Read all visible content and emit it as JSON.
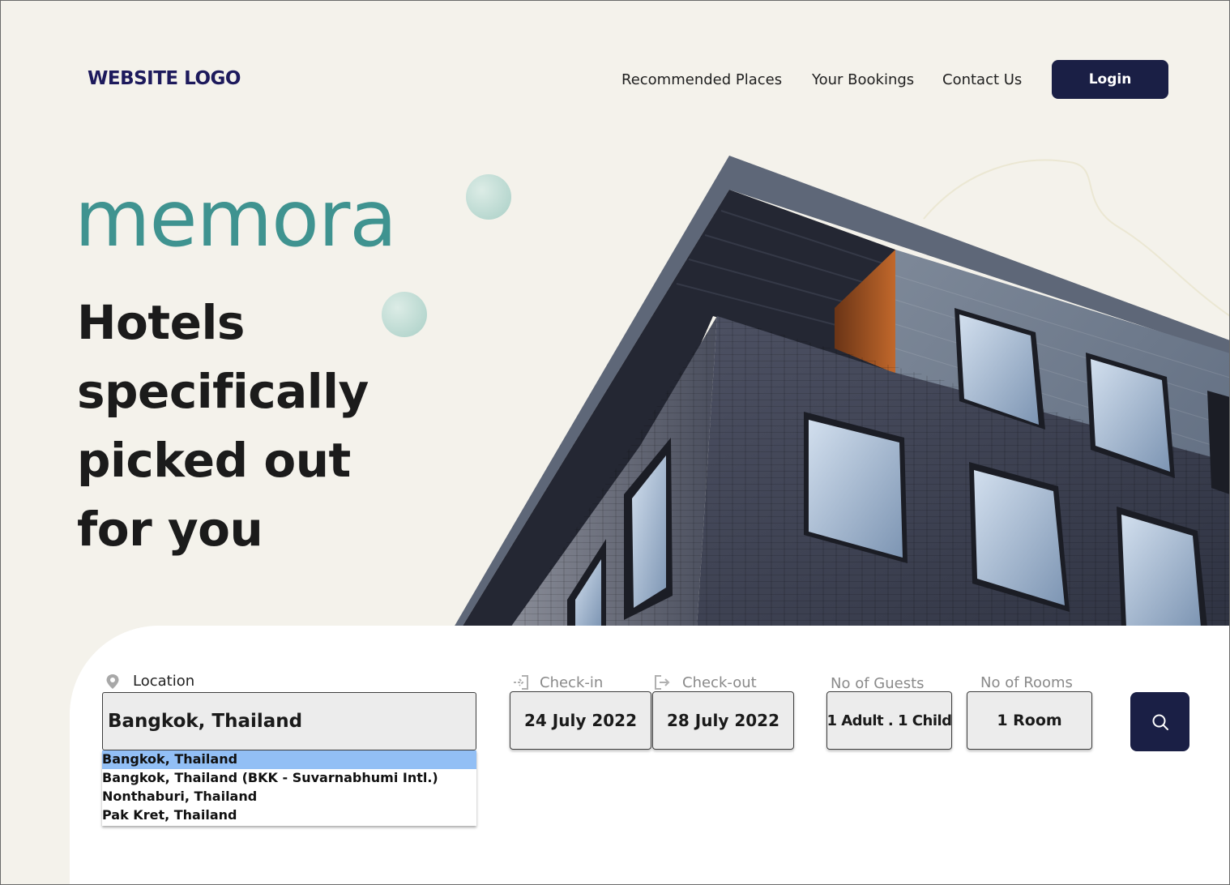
{
  "header": {
    "logo": "WEBSITE LOGO",
    "nav": [
      {
        "label": "Recommended Places"
      },
      {
        "label": "Your Bookings"
      },
      {
        "label": "Contact Us"
      }
    ],
    "login_label": "Login"
  },
  "hero": {
    "brand": "memora",
    "tagline_lines": [
      "Hotels",
      "specifically",
      "picked out",
      "for you"
    ]
  },
  "search": {
    "location_label": "Location",
    "location_value": "Bangkok, Thailand",
    "suggestions": [
      "Bangkok, Thailand",
      "Bangkok, Thailand (BKK - Suvarnabhumi Intl.)",
      "Nonthaburi, Thailand",
      "Pak Kret, Thailand"
    ],
    "selected_suggestion": 0,
    "checkin_label": "Check-in",
    "checkin_value": "24 July 2022",
    "checkout_label": "Check-out",
    "checkout_value": "28 July 2022",
    "guests_label": "No of Guests",
    "guests_value": "1 Adult . 1 Child",
    "rooms_label": "No of Rooms",
    "rooms_value": "1 Room",
    "search_icon": "search-icon"
  },
  "colors": {
    "background": "#f4f2eb",
    "accent_teal": "#3f9390",
    "brand_navy": "#1a1f45",
    "logo_color": "#1d1a5c",
    "dropdown_highlight": "#92bff5"
  }
}
